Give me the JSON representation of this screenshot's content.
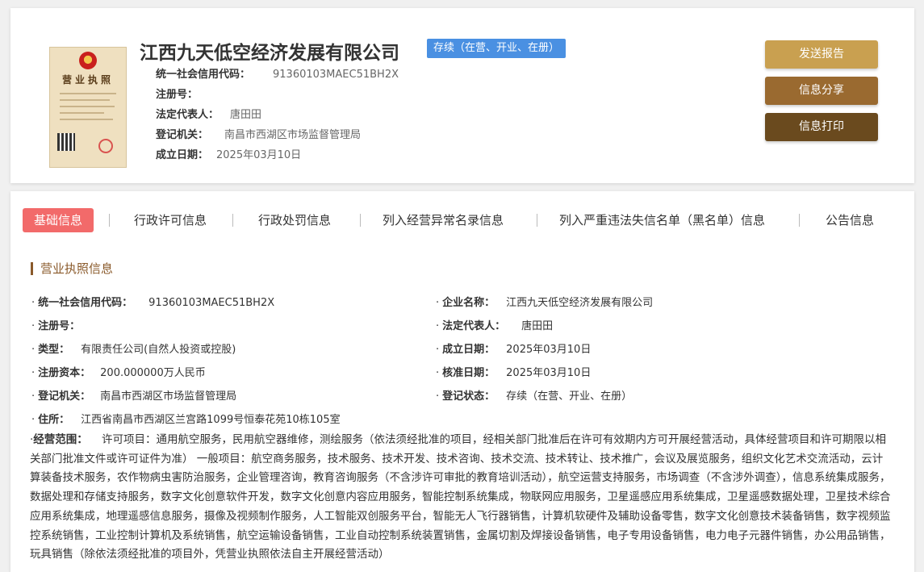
{
  "header": {
    "license_image_alt": "营业执照",
    "license_thumb_title": "营业执照",
    "company_name": "江西九天低空经济发展有限公司",
    "status": "存续（在营、开业、在册）",
    "info": [
      {
        "label": "统一社会信用代码：",
        "value": "91360103MAEC51BH2X"
      },
      {
        "label": "注册号：",
        "value": ""
      },
      {
        "label": "法定代表人：",
        "value": "唐田田"
      },
      {
        "label": "登记机关：",
        "value": "南昌市西湖区市场监督管理局"
      },
      {
        "label": "成立日期：",
        "value": "2025年03月10日"
      }
    ],
    "buttons": [
      {
        "label": "发送报告",
        "color": "#c9a050"
      },
      {
        "label": "信息分享",
        "color": "#9a6a30"
      },
      {
        "label": "信息打印",
        "color": "#6a4a1e"
      }
    ]
  },
  "tabs": [
    {
      "label": "基础信息",
      "active": true
    },
    {
      "label": "行政许可信息"
    },
    {
      "label": "行政处罚信息"
    },
    {
      "label": "列入经营异常名录信息"
    },
    {
      "label": "列入严重违法失信名单（黑名单）信息"
    },
    {
      "label": "公告信息"
    }
  ],
  "section": {
    "title": "营业执照信息",
    "fields": {
      "credit_code": {
        "label": "统一社会信用代码：",
        "value": "91360103MAEC51BH2X"
      },
      "company_name": {
        "label": "企业名称：",
        "value": "江西九天低空经济发展有限公司"
      },
      "reg_no": {
        "label": "注册号：",
        "value": ""
      },
      "legal_rep": {
        "label": "法定代表人：",
        "value": "唐田田"
      },
      "type": {
        "label": "类型：",
        "value": "有限责任公司(自然人投资或控股)"
      },
      "established": {
        "label": "成立日期：",
        "value": "2025年03月10日"
      },
      "capital": {
        "label": "注册资本：",
        "value": "200.000000万人民币"
      },
      "approval_date": {
        "label": "核准日期：",
        "value": "2025年03月10日"
      },
      "authority": {
        "label": "登记机关：",
        "value": "南昌市西湖区市场监督管理局"
      },
      "reg_status": {
        "label": "登记状态：",
        "value": "存续（在营、开业、在册）"
      },
      "address": {
        "label": "住所：",
        "value": "江西省南昌市西湖区兰宫路1099号恒泰花苑10栋105室"
      }
    },
    "scope_label": "经营范围：",
    "scope_text": "许可项目：通用航空服务，民用航空器维修，测绘服务（依法须经批准的项目，经相关部门批准后在许可有效期内方可开展经营活动，具体经营项目和许可期限以相关部门批准文件或许可证件为准） 一般项目：航空商务服务，技术服务、技术开发、技术咨询、技术交流、技术转让、技术推广，会议及展览服务，组织文化艺术交流活动，云计算装备技术服务，农作物病虫害防治服务，企业管理咨询，教育咨询服务（不含涉许可审批的教育培训活动），航空运营支持服务，市场调查（不含涉外调查），信息系统集成服务，数据处理和存储支持服务，数字文化创意软件开发，数字文化创意内容应用服务，智能控制系统集成，物联网应用服务，卫星遥感应用系统集成，卫星遥感数据处理，卫星技术综合应用系统集成，地理遥感信息服务，摄像及视频制作服务，人工智能双创服务平台，智能无人飞行器销售，计算机软硬件及辅助设备零售，数字文化创意技术装备销售，数字视频监控系统销售，工业控制计算机及系统销售，航空运输设备销售，工业自动控制系统装置销售，金属切割及焊接设备销售，电子专用设备销售，电力电子元器件销售，办公用品销售，玩具销售（除依法须经批准的项目外，凭营业执照依法自主开展经营活动）"
  }
}
